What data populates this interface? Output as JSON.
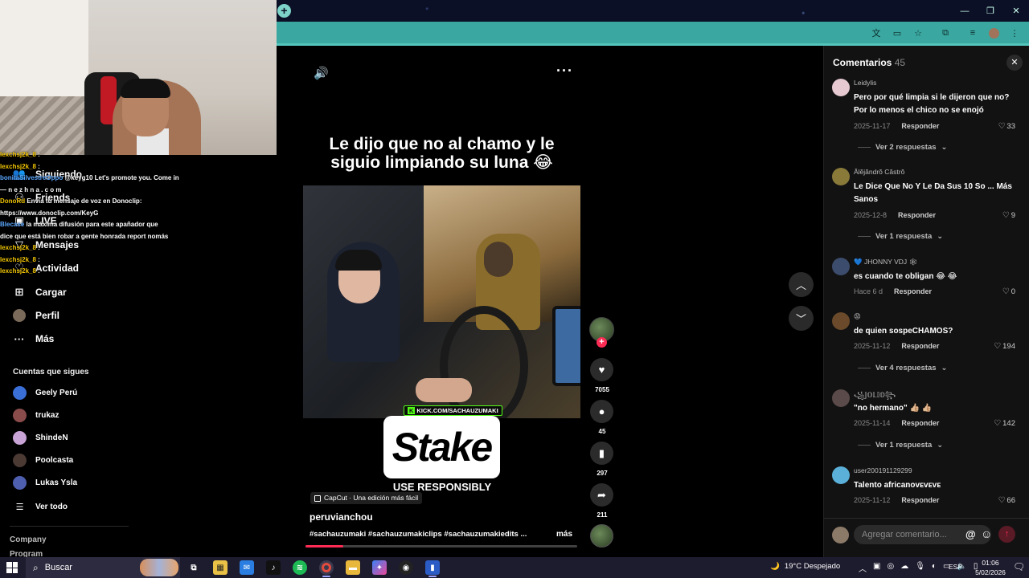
{
  "stream_overlay": {
    "chat": [
      {
        "user": "lexchsj2k_8",
        "msg": ":",
        "color": "yellow"
      },
      {
        "user": "bonitaSilvestreOppo",
        "msg": "@keyg10 Let's promote you. Come in",
        "color": "blue"
      },
      {
        "user": "",
        "msg": "— n e z h n a . c o m",
        "color": "yellow"
      },
      {
        "user": "DonoRd",
        "msg": "Envía tu mensaje de voz en Donoclip:",
        "color": "yellow"
      },
      {
        "user": "",
        "msg": "https://www.donoclip.com/KeyG",
        "color": "yellow"
      },
      {
        "user": "Blecase",
        "msg": "la máxima difusión para este apañador que",
        "color": "blue"
      },
      {
        "user": "",
        "msg": "dice que está bien robar a gente honrada report nomás",
        "color": "yellow"
      },
      {
        "user": "lexchsj2k_8",
        "msg": ":",
        "color": "yellow"
      },
      {
        "user": "lexchsj2k_8",
        "msg": ":",
        "color": "yellow"
      },
      {
        "user": "lexchsj2k_8",
        "msg": ":",
        "color": "yellow"
      }
    ]
  },
  "leftnav": {
    "items": [
      {
        "label": "Siguiendo",
        "icon": "following-icon"
      },
      {
        "label": "Friends",
        "icon": "friends-icon"
      },
      {
        "label": "LIVE",
        "icon": "live-icon"
      },
      {
        "label": "Mensajes",
        "icon": "messages-icon"
      },
      {
        "label": "Actividad",
        "icon": "activity-icon"
      },
      {
        "label": "Cargar",
        "icon": "upload-icon"
      },
      {
        "label": "Perfil",
        "icon": "profile-icon"
      },
      {
        "label": "Más",
        "icon": "more-icon"
      }
    ],
    "following_title": "Cuentas que sigues",
    "following": [
      {
        "name": "Geely Perú",
        "color": "#3b6fd8"
      },
      {
        "name": "trukaz",
        "color": "#8a4b4b"
      },
      {
        "name": "ShindeN",
        "color": "#c8a3d6"
      },
      {
        "name": "Poolcasta",
        "color": "#4a3a33"
      },
      {
        "name": "Lukas Ysla",
        "color": "#4e5fb0"
      }
    ],
    "see_all": "Ver todo",
    "footer": [
      "Company",
      "Program"
    ]
  },
  "browser": {
    "new_tab": "+",
    "window_controls": [
      "—",
      "❐",
      "✕"
    ]
  },
  "video": {
    "caption": "Le dijo que no al chamo y le siguio limpiando su luna 😂",
    "kick_badge": "KICK.COM/SACHAUZUMAKI",
    "stake_logo": "Stake",
    "stake_tag": "USE RESPONSIBLY",
    "capcut": "CapCut · Una edición más fácil",
    "author": "peruvianchou",
    "tags": "#sachauzumaki #sachauzumakiclips #sachauzumakiedits ...",
    "more": "más",
    "progress": 0.14,
    "likes": "7055",
    "comments": "45",
    "saves": "297",
    "shares": "211"
  },
  "comments_panel": {
    "title": "Comentarios",
    "count": "45",
    "input_placeholder": "Agregar comentario...",
    "reply_label": "Responder",
    "items": [
      {
        "user": "Leidylis",
        "text": "Pero por qué limpia si le dijeron que no? Por lo menos el chico no se enojó",
        "date": "2025-11-17",
        "likes": "33",
        "replies": "Ver 2 respuestas",
        "avatar": "#e6c9d1"
      },
      {
        "user": "Ălĕjăndrŏ Căstrŏ",
        "text": "Le Dice Que No Y Le Da Sus 10 So ... Más Sanos",
        "date": "2025-12-8",
        "likes": "9",
        "replies": "Ver 1 respuesta",
        "avatar": "#8a7a3a"
      },
      {
        "user": "💙 JHONNY VDJ 🕸",
        "text": "es cuando te obligan 😂 😂",
        "date": "Hace 6 d",
        "likes": "0",
        "replies": "",
        "avatar": "#3c4c6c"
      },
      {
        "user": "😡",
        "text": "de quien sospeCHAMOS?",
        "date": "2025-11-12",
        "likes": "194",
        "replies": "Ver 4 respuestas",
        "avatar": "#6a4a2a"
      },
      {
        "user": "꧁𝕁𝕆𝕃𝕀𝕆꧂",
        "text": "\"no hermano\" 👍🏼 👍🏼",
        "date": "2025-11-14",
        "likes": "142",
        "replies": "Ver 1 respuesta",
        "avatar": "#5b4a4a"
      },
      {
        "user": "user200191129299",
        "text": "Talento africanoᴠᴇᴠᴇᴠᴇ",
        "date": "2025-11-12",
        "likes": "66",
        "replies": "",
        "avatar": "#5ab0d8"
      }
    ]
  },
  "taskbar": {
    "search": "Buscar",
    "weather": "19°C  Despejado",
    "lang": "ESP",
    "time": "01:06",
    "date": "5/02/2026"
  }
}
